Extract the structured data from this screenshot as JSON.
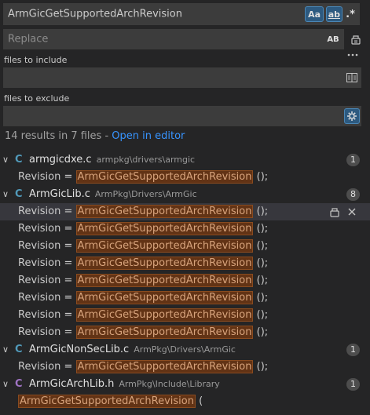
{
  "search": {
    "query": "ArmGicGetSupportedArchRevision",
    "case_label": "Aa",
    "word_label": "ab",
    "regex_label": ".*"
  },
  "replace": {
    "placeholder": "Replace",
    "preserve_case_label": "AB"
  },
  "include": {
    "label": "files to include",
    "value": ""
  },
  "exclude": {
    "label": "files to exclude",
    "value": ""
  },
  "summary": {
    "text": "14 results in 7 files - ",
    "open_editor": "Open in editor"
  },
  "colors": {
    "match_bg": "#623315",
    "link": "#3794ff",
    "c_icon": "#519aba",
    "h_icon": "#a074c4"
  },
  "files": [
    {
      "name": "armgicdxe.c",
      "path": "armpkg\\drivers\\armgic",
      "icon": "C",
      "count": "1",
      "matches": [
        {
          "pre": "Revision = ",
          "hit": "ArmGicGetSupportedArchRevision",
          "post": " ();"
        }
      ]
    },
    {
      "name": "ArmGicLib.c",
      "path": "ArmPkg\\Drivers\\ArmGic",
      "icon": "C",
      "count": "8",
      "matches": [
        {
          "pre": "Revision = ",
          "hit": "ArmGicGetSupportedArchRevision",
          "post": " ();"
        },
        {
          "pre": "Revision = ",
          "hit": "ArmGicGetSupportedArchRevision",
          "post": " ();"
        },
        {
          "pre": "Revision = ",
          "hit": "ArmGicGetSupportedArchRevision",
          "post": " ();"
        },
        {
          "pre": "Revision = ",
          "hit": "ArmGicGetSupportedArchRevision",
          "post": " ();"
        },
        {
          "pre": "Revision = ",
          "hit": "ArmGicGetSupportedArchRevision",
          "post": " ();"
        },
        {
          "pre": "Revision = ",
          "hit": "ArmGicGetSupportedArchRevision",
          "post": " ();"
        },
        {
          "pre": "Revision = ",
          "hit": "ArmGicGetSupportedArchRevision",
          "post": " ();"
        },
        {
          "pre": "Revision = ",
          "hit": "ArmGicGetSupportedArchRevision",
          "post": " ();"
        }
      ]
    },
    {
      "name": "ArmGicNonSecLib.c",
      "path": "ArmPkg\\Drivers\\ArmGic",
      "icon": "C",
      "count": "1",
      "matches": [
        {
          "pre": "Revision = ",
          "hit": "ArmGicGetSupportedArchRevision",
          "post": " ();"
        }
      ]
    },
    {
      "name": "ArmGicArchLib.h",
      "path": "ArmPkg\\Include\\Library",
      "icon": "C",
      "count": "1",
      "matches": [
        {
          "pre": "",
          "hit": "ArmGicGetSupportedArchRevision",
          "post": " ("
        }
      ]
    }
  ]
}
